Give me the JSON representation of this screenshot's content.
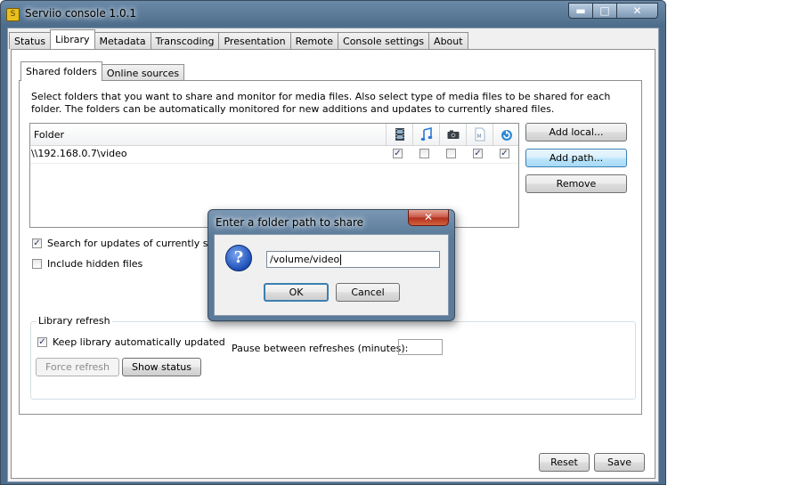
{
  "window": {
    "title": "Serviio console 1.0.1",
    "minimize": "▬",
    "maximize": "□",
    "close": "✕"
  },
  "tabs": [
    {
      "label": "Status"
    },
    {
      "label": "Library"
    },
    {
      "label": "Metadata"
    },
    {
      "label": "Transcoding"
    },
    {
      "label": "Presentation"
    },
    {
      "label": "Remote"
    },
    {
      "label": "Console settings"
    },
    {
      "label": "About"
    }
  ],
  "subtabs": [
    {
      "label": "Shared folders"
    },
    {
      "label": "Online sources"
    }
  ],
  "description": "Select folders that you want to share and monitor for media files. Also select type of media files to be shared for each folder. The folders can be automatically monitored for new additions and updates to currently shared files.",
  "table": {
    "folder_header": "Folder",
    "media_icons": [
      "video-icon",
      "audio-icon",
      "image-icon",
      "metadata-icon",
      "refresh-icon"
    ],
    "rows": [
      {
        "path": "\\\\192.168.0.7\\video",
        "checks": [
          true,
          false,
          false,
          true,
          true
        ]
      }
    ]
  },
  "buttons": {
    "add_local": "Add local...",
    "add_path": "Add path...",
    "remove": "Remove",
    "force_refresh": "Force refresh",
    "show_status": "Show status",
    "reset": "Reset",
    "save": "Save"
  },
  "options": {
    "search_updates": "Search for updates of currently share",
    "include_hidden": "Include hidden files"
  },
  "library_refresh": {
    "title": "Library refresh",
    "keep_updated": "Keep library automatically updated",
    "pause_label": "Pause between refreshes (minutes):"
  },
  "dialog": {
    "title": "Enter a folder path to share",
    "close": "✕",
    "icon": "?",
    "value": "/volume/video",
    "ok": "OK",
    "cancel": "Cancel"
  }
}
